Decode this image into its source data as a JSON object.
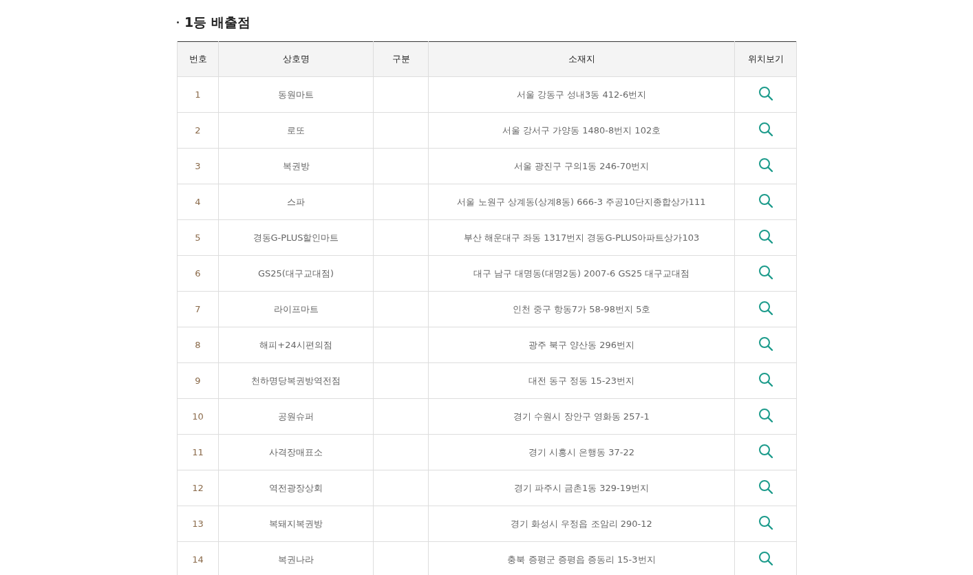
{
  "section_title": "1등 배출점",
  "table": {
    "columns": [
      "번호",
      "상호명",
      "구분",
      "소재지",
      "위치보기"
    ],
    "rows": [
      {
        "number": "1",
        "name": "동원마트",
        "address": "서울 강동구 성내3동 412-6번지"
      },
      {
        "number": "2",
        "name": "로또",
        "address": "서울 강서구 가양동 1480-8번지 102호"
      },
      {
        "number": "3",
        "name": "복권방",
        "address": "서울 광진구 구의1동 246-70번지"
      },
      {
        "number": "4",
        "name": "스파",
        "address": "서울 노원구 상계동(상계8동) 666-3 주공10단지종합상가111"
      },
      {
        "number": "5",
        "name": "경동G-PLUS할인마트",
        "address": "부산 해운대구 좌동 1317번지 경동G-PLUS아파트상가103"
      },
      {
        "number": "6",
        "name": "GS25(대구교대점)",
        "address": "대구 남구 대명동(대명2동) 2007-6 GS25 대구교대점"
      },
      {
        "number": "7",
        "name": "라이프마트",
        "address": "인천 중구 항동7가 58-98번지 5호"
      },
      {
        "number": "8",
        "name": "해피+24시편의점",
        "address": "광주 북구 양산동 296번지"
      },
      {
        "number": "9",
        "name": "천하명당복권방역전점",
        "address": "대전 동구 정동 15-23번지"
      },
      {
        "number": "10",
        "name": "공원슈퍼",
        "address": "경기 수원시 장안구 영화동 257-1"
      },
      {
        "number": "11",
        "name": "사격장매표소",
        "address": "경기 시흥시 은행동 37-22"
      },
      {
        "number": "12",
        "name": "역전광장상회",
        "address": "경기 파주시 금촌1동 329-19번지"
      },
      {
        "number": "13",
        "name": "복돼지복권방",
        "address": "경기 화성시 우정읍 조암리 290-12"
      },
      {
        "number": "14",
        "name": "복권나라",
        "address": "충북 증평군 증평읍 증동리 15-3번지"
      }
    ]
  }
}
